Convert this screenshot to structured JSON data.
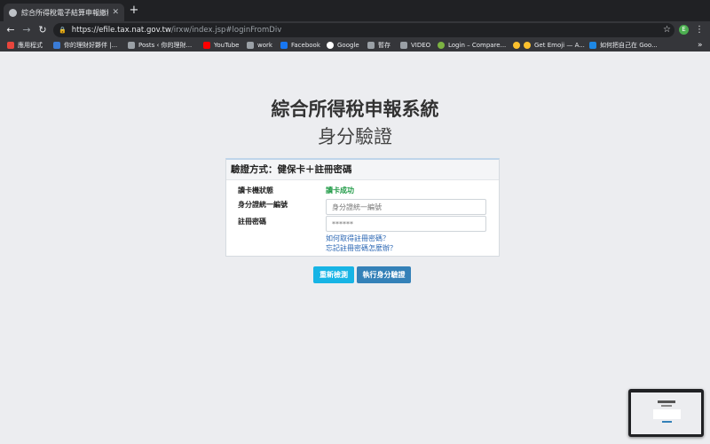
{
  "browser": {
    "tab_title": "綜合所得稅電子結算申報繳稅系",
    "new_tab": "+",
    "url_host": "https://efile.tax.nat.gov.tw",
    "url_path": "/irxw/index.jsp#loginFromDiv",
    "profile_initial": "E",
    "bookmarks": [
      {
        "label": "應用程式",
        "color": "#e8453c"
      },
      {
        "label": "你的理財好夥伴 |...",
        "color": "#3a7bd5"
      },
      {
        "label": "Posts ‹ 你的理財...",
        "color": "#9aa0a6"
      },
      {
        "label": "YouTube",
        "color": "#ff0000"
      },
      {
        "label": "work",
        "color": "#9aa0a6"
      },
      {
        "label": "Facebook",
        "color": "#1877f2"
      },
      {
        "label": "Google",
        "color": "#ffffff"
      },
      {
        "label": "暫存",
        "color": "#9aa0a6"
      },
      {
        "label": "VIDEO",
        "color": "#9aa0a6"
      },
      {
        "label": "Login – Compare...",
        "color": "#7cb342"
      },
      {
        "label": "Get Emoji — A...",
        "color": "#fbc02d"
      },
      {
        "label": "如何把自己在 Goo...",
        "color": "#1e88e5"
      }
    ],
    "bookmarks_more": "»"
  },
  "page": {
    "title": "綜合所得稅申報系統",
    "subtitle": "身分驗證",
    "panel": {
      "heading": "驗證方式：健保卡＋註冊密碼",
      "card_status_label": "讀卡機狀態",
      "card_status_value": "讀卡成功",
      "id_label": "身分證統一編號",
      "id_placeholder": "身分證統一編號",
      "password_label": "註冊密碼",
      "password_placeholder": "******",
      "link_get_password": "如何取得註冊密碼？",
      "link_forgot_password": "忘記註冊密碼怎麼辦？"
    },
    "buttons": {
      "recheck": "重新檢測",
      "verify": "執行身分驗證"
    }
  }
}
